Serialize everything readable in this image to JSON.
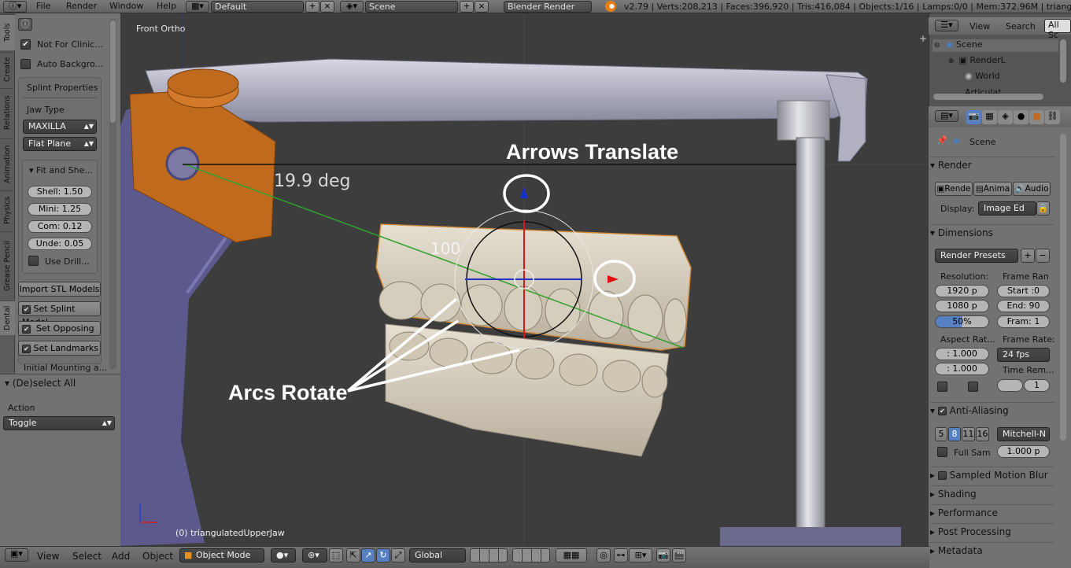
{
  "topbar": {
    "menus": [
      "File",
      "Render",
      "Window",
      "Help"
    ],
    "layout": "Default",
    "scene": "Scene",
    "engine": "Blender Render",
    "stats": "v2.79 | Verts:208,213 | Faces:396,920 | Tris:416,084 | Objects:1/16 | Lamps:0/0 | Mem:372.96M | triangulated"
  },
  "tabs": [
    "Tools",
    "Create",
    "Relations",
    "Animation",
    "Physics",
    "Grease Pencil",
    "Dental"
  ],
  "toolpanel": {
    "not_for_clinical": "Not For Clinic...",
    "auto_background": "Auto Backgro...",
    "splint_properties": "Splint Properties",
    "jaw_type_label": "Jaw Type",
    "jaw_type": "MAXILLA",
    "plane": "Flat Plane",
    "fit_shell": "Fit and She...",
    "shell": "Shell: 1.50",
    "mini": "Mini:  1.25",
    "com": "Com:  0.12",
    "unde": "Unde: 0.05",
    "use_drill": "Use Drill...",
    "import_stl": "Import STL Models",
    "set_splint": "Set Splint Model",
    "set_opposing": "Set Opposing",
    "set_landmarks": "Set Landmarks",
    "initial_mounting": "Initial Mounting a..."
  },
  "operator": {
    "title": "(De)select All",
    "action_label": "Action",
    "action_value": "Toggle"
  },
  "viewport": {
    "view_name": "Front Ortho",
    "object_name": "(0) triangulatedUpperJaw",
    "angle": "19.9 deg",
    "scale_value": "100",
    "annotation_arrows": "Arrows Translate",
    "annotation_arcs": "Arcs Rotate"
  },
  "outliner": {
    "view": "View",
    "search": "Search",
    "all_scenes": "All Sc",
    "items": [
      "Scene",
      "RenderL",
      "World",
      "Articulat"
    ]
  },
  "properties": {
    "scene": "Scene",
    "render_section": "Render",
    "render_btn": "Rende",
    "anim_btn": "Anima",
    "audio_btn": "Audio",
    "display_label": "Display:",
    "display_value": "Image Ed",
    "dimensions_section": "Dimensions",
    "render_presets": "Render Presets",
    "resolution_label": "Resolution:",
    "frame_range_label": "Frame Ran",
    "res_x": "1920 p",
    "res_y": "1080 p",
    "res_pct": "50%",
    "start": "Start :0",
    "end": "End: 90",
    "frame": "Fram: 1",
    "aspect_label": "Aspect Rat...",
    "frame_rate_label": "Frame Rate:",
    "aspect_x": ": 1.000",
    "aspect_y": ": 1.000",
    "fps": "24 fps",
    "time_rem": "Time Rem...",
    "time_val": "1",
    "aa_section": "Anti-Aliasing",
    "aa_samples": [
      "5",
      "8",
      "11",
      "16"
    ],
    "filter": "Mitchell-N",
    "full_sample": "Full Sam",
    "filter_size": "1.000 p",
    "motion_blur": "Sampled Motion Blur",
    "shading": "Shading",
    "performance": "Performance",
    "post_processing": "Post Processing",
    "metadata": "Metadata"
  },
  "bottombar": {
    "menus": [
      "View",
      "Select",
      "Add",
      "Object"
    ],
    "mode": "Object Mode",
    "orientation": "Global"
  },
  "colors": {
    "accent_blue": "#5680c2",
    "bracket_orange": "#c06a1e",
    "arm_purple": "#5c5a8c",
    "axis_green": "#2ea12e"
  }
}
